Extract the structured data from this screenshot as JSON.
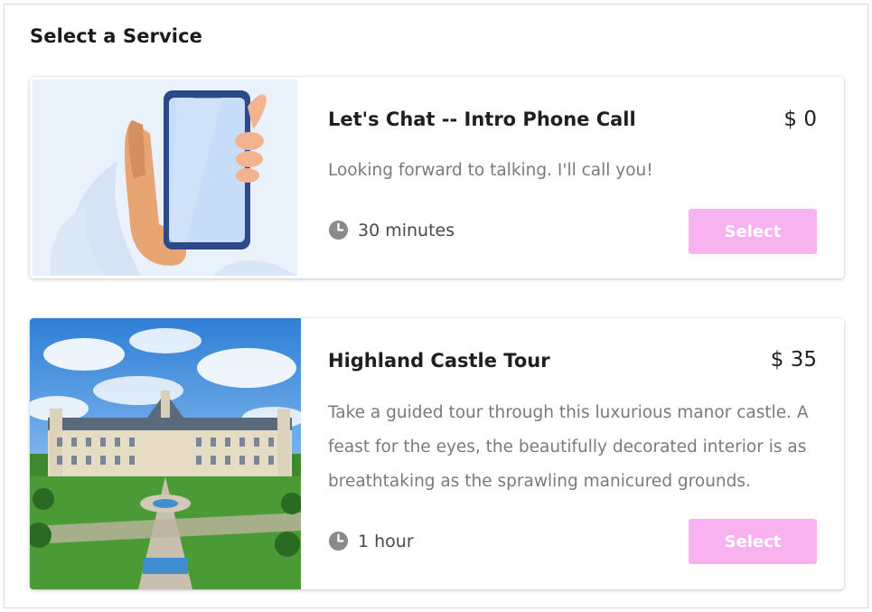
{
  "page": {
    "heading": "Select a Service"
  },
  "services": [
    {
      "title": "Let's Chat -- Intro Phone Call",
      "price": "$ 0",
      "description": "Looking forward to talking. I'll call you!",
      "duration": "30 minutes",
      "button_label": "Select",
      "image": "phone-in-hand-illustration"
    },
    {
      "title": "Highland Castle Tour",
      "price": "$ 35",
      "description": "Take a guided tour through this luxurious manor castle. A feast for the eyes, the beautifully decorated interior is as breathtaking as the sprawling manicured grounds.",
      "duration": "1 hour",
      "button_label": "Select",
      "image": "castle-aerial-photo"
    }
  ],
  "colors": {
    "accent_button": "#f8b2ef",
    "muted_text": "#7a7a7a",
    "clock_icon": "#8a8a8a"
  },
  "icons": {
    "duration": "clock-icon"
  }
}
